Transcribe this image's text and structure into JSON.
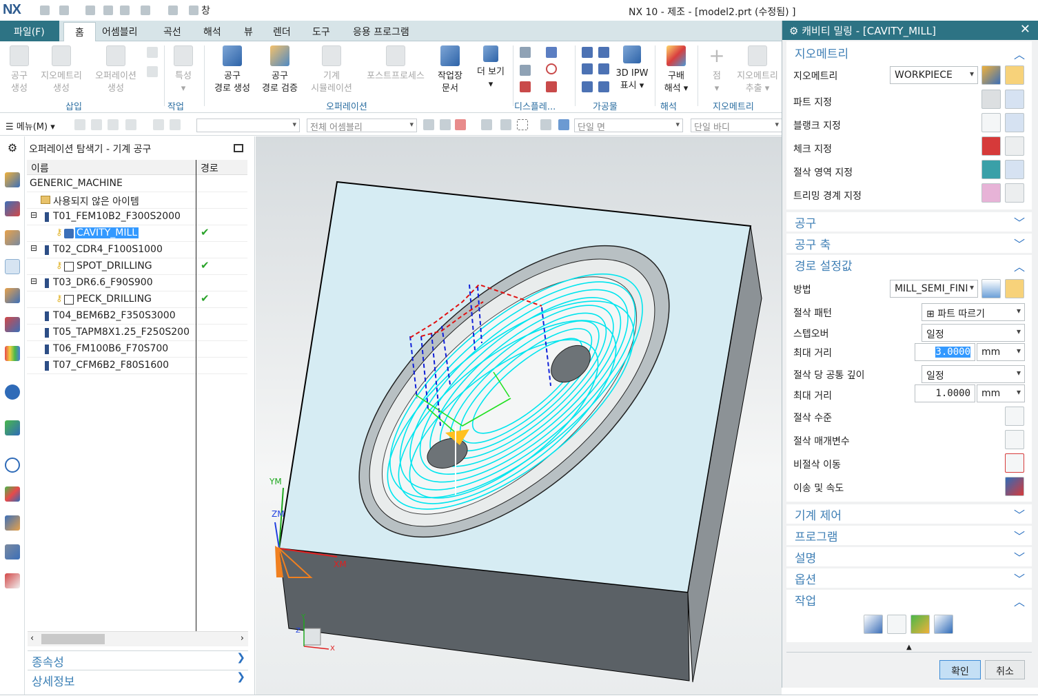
{
  "window": {
    "title": "NX 10 - 제조 - [model2.prt (수정됨) ]",
    "logo": "NX",
    "window_menu": "창"
  },
  "tabs": [
    "파일(F)",
    "홈",
    "어셈블리",
    "곡선",
    "해석",
    "뷰",
    "렌더",
    "도구",
    "응용 프로그램"
  ],
  "ribbon": {
    "buttons": [
      {
        "l1": "공구",
        "l2": "생성",
        "dim": true,
        "icon": "tool-create-icon"
      },
      {
        "l1": "지오메트리",
        "l2": "생성",
        "dim": true,
        "icon": "geometry-create-icon"
      },
      {
        "l1": "오퍼레이션",
        "l2": "생성",
        "dim": true,
        "icon": "operation-create-icon"
      },
      {
        "l1": "특성",
        "l2": "▾",
        "dim": true,
        "icon": "properties-icon"
      },
      {
        "l1": "공구",
        "l2": "경로 생성",
        "dim": false,
        "icon": "generate-toolpath-icon"
      },
      {
        "l1": "공구",
        "l2": "경로 검증",
        "dim": false,
        "icon": "verify-toolpath-icon"
      },
      {
        "l1": "기계",
        "l2": "시뮬레이션",
        "dim": true,
        "icon": "machine-simulation-icon"
      },
      {
        "l1": "포스트프로세스",
        "l2": "",
        "dim": true,
        "icon": "postprocess-icon"
      },
      {
        "l1": "작업장",
        "l2": "문서",
        "dim": false,
        "icon": "shop-docs-icon"
      },
      {
        "l1": "더 보기",
        "l2": "▾",
        "dim": false,
        "icon": "more-icon"
      },
      {
        "l1": "3D IPW",
        "l2": "표시 ▾",
        "dim": false,
        "icon": "3d-ipw-icon"
      },
      {
        "l1": "구배",
        "l2": "해석 ▾",
        "dim": false,
        "icon": "draft-analysis-icon"
      },
      {
        "l1": "점",
        "l2": "▾",
        "dim": true,
        "icon": "point-icon"
      },
      {
        "l1": "지오메트리",
        "l2": "추출 ▾",
        "dim": true,
        "icon": "extract-geometry-icon"
      }
    ],
    "groups": [
      "삽입",
      "작업",
      "오퍼레이션",
      "디스플레...",
      "가공물",
      "해석",
      "지오메트리"
    ]
  },
  "toolbar2": {
    "menu_label": "메뉴(M)",
    "assembly_filter": "전체 어셈블리",
    "face_rule": "단일 면",
    "body_rule": "단일 바디"
  },
  "navigator": {
    "title": "오퍼레이션 탐색기 - 기계 공구",
    "col_name": "이름",
    "col_path": "경로",
    "rows": [
      {
        "label": "GENERIC_MACHINE",
        "indent": 0,
        "check": ""
      },
      {
        "label": "사용되지 않은 아이템",
        "indent": 1,
        "check": ""
      },
      {
        "label": "T01_FEM10B2_F300S2000",
        "indent": 1,
        "check": ""
      },
      {
        "label": "CAVITY_MILL",
        "indent": 2,
        "check": "✔",
        "selected": true
      },
      {
        "label": "T02_CDR4_F100S1000",
        "indent": 1,
        "check": ""
      },
      {
        "label": "SPOT_DRILLING",
        "indent": 2,
        "check": "✔"
      },
      {
        "label": "T03_DR6.6_F90S900",
        "indent": 1,
        "check": ""
      },
      {
        "label": "PECK_DRILLING",
        "indent": 2,
        "check": "✔"
      },
      {
        "label": "T04_BEM6B2_F350S3000",
        "indent": 1,
        "check": ""
      },
      {
        "label": "T05_TAPM8X1.25_F250S200",
        "indent": 1,
        "check": ""
      },
      {
        "label": "T06_FM100B6_F70S700",
        "indent": 1,
        "check": ""
      },
      {
        "label": "T07_CFM6B2_F80S1600",
        "indent": 1,
        "check": ""
      }
    ],
    "sections": [
      "종속성",
      "상세정보"
    ]
  },
  "viewport": {
    "axis_ym": "YM",
    "axis_zm": "ZM",
    "axis_xm": "XM",
    "axis_y": "Y",
    "axis_z": "Z",
    "axis_x": "X"
  },
  "dialog": {
    "title": "캐비티 밀링 - [CAVITY_MILL]",
    "geometry_section": "지오메트리",
    "geometry_label": "지오메트리",
    "geometry_value": "WORKPIECE",
    "geometry_rows": [
      "파트 지정",
      "블랭크 지정",
      "체크 지정",
      "절삭 영역 지정",
      "트리밍 경계 지정"
    ],
    "tool_section": "공구",
    "axis_section": "공구 축",
    "path_section": "경로 설정값",
    "method_label": "방법",
    "method_value": "MILL_SEMI_FINI",
    "cut_pattern_label": "절삭 패턴",
    "cut_pattern_value": "파트 따르기",
    "stepover_label": "스텝오버",
    "stepover_value": "일정",
    "max_dist_label": "최대 거리",
    "max_dist_value": "3.0000",
    "unit": "mm",
    "common_depth_label": "절삭 당 공통 깊이",
    "common_depth_value": "일정",
    "max_dist2_label": "최대 거리",
    "max_dist2_value": "1.0000",
    "cut_levels": "절삭 수준",
    "cut_params": "절삭 매개변수",
    "noncut_moves": "비절삭 이동",
    "feeds_speeds": "이송 및 속도",
    "sections_collapsed": [
      "기계 제어",
      "프로그램",
      "설명",
      "옵션"
    ],
    "actions_section": "작업",
    "ok": "확인",
    "cancel": "취소"
  }
}
